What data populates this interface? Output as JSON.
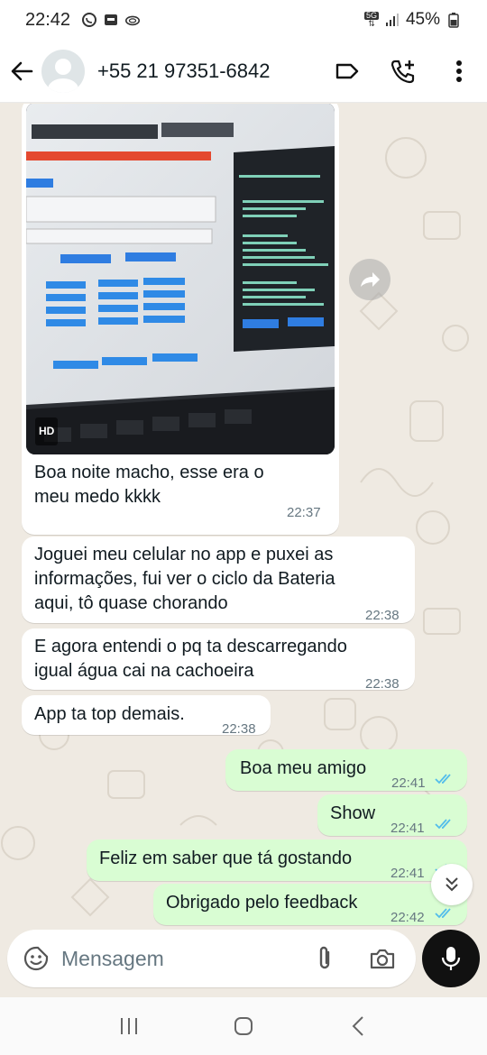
{
  "status_bar": {
    "time": "22:42",
    "network": "5G",
    "battery": "45%"
  },
  "header": {
    "contact": "+55 21 97351-6842"
  },
  "photo": {
    "badge": "HD"
  },
  "messages": [
    {
      "direction": "in",
      "text_lines": [
        "Boa noite macho, esse era o",
        "meu medo kkkk"
      ],
      "time": "22:37"
    },
    {
      "direction": "in",
      "text_lines": [
        "Joguei meu celular no app e puxei as",
        "informações, fui ver o ciclo da Bateria",
        "aqui, tô quase chorando"
      ],
      "time": "22:38"
    },
    {
      "direction": "in",
      "text_lines": [
        "E agora entendi o pq ta descarregando",
        "igual água cai na cachoeira"
      ],
      "time": "22:38"
    },
    {
      "direction": "in",
      "text_lines": [
        "App ta top demais."
      ],
      "time": "22:38"
    },
    {
      "direction": "out",
      "text_lines": [
        "Boa meu amigo"
      ],
      "time": "22:41",
      "status": "read"
    },
    {
      "direction": "out",
      "text_lines": [
        "Show"
      ],
      "time": "22:41",
      "status": "read"
    },
    {
      "direction": "out",
      "text_lines": [
        "Feliz em saber que tá gostando"
      ],
      "time": "22:41",
      "status": "read"
    },
    {
      "direction": "out",
      "text_lines": [
        "Obrigado pelo feedback"
      ],
      "time": "22:42",
      "status": "read"
    }
  ],
  "composer": {
    "placeholder": "Mensagem"
  },
  "colors": {
    "incoming_bubble": "#ffffff",
    "outgoing_bubble": "#d9fdd3",
    "chat_background": "#efeae2",
    "read_ticks": "#53bdeb",
    "timestamp": "#667781"
  },
  "icons": {
    "back": "arrow-left-icon",
    "label": "label-tag-icon",
    "add_call": "phone-plus-icon",
    "more": "more-vertical-icon",
    "forward": "forward-icon",
    "emoji": "sticker-emoji-icon",
    "attach": "paperclip-icon",
    "camera": "camera-icon",
    "mic": "microphone-icon",
    "scroll_down": "double-chevron-down-icon"
  }
}
